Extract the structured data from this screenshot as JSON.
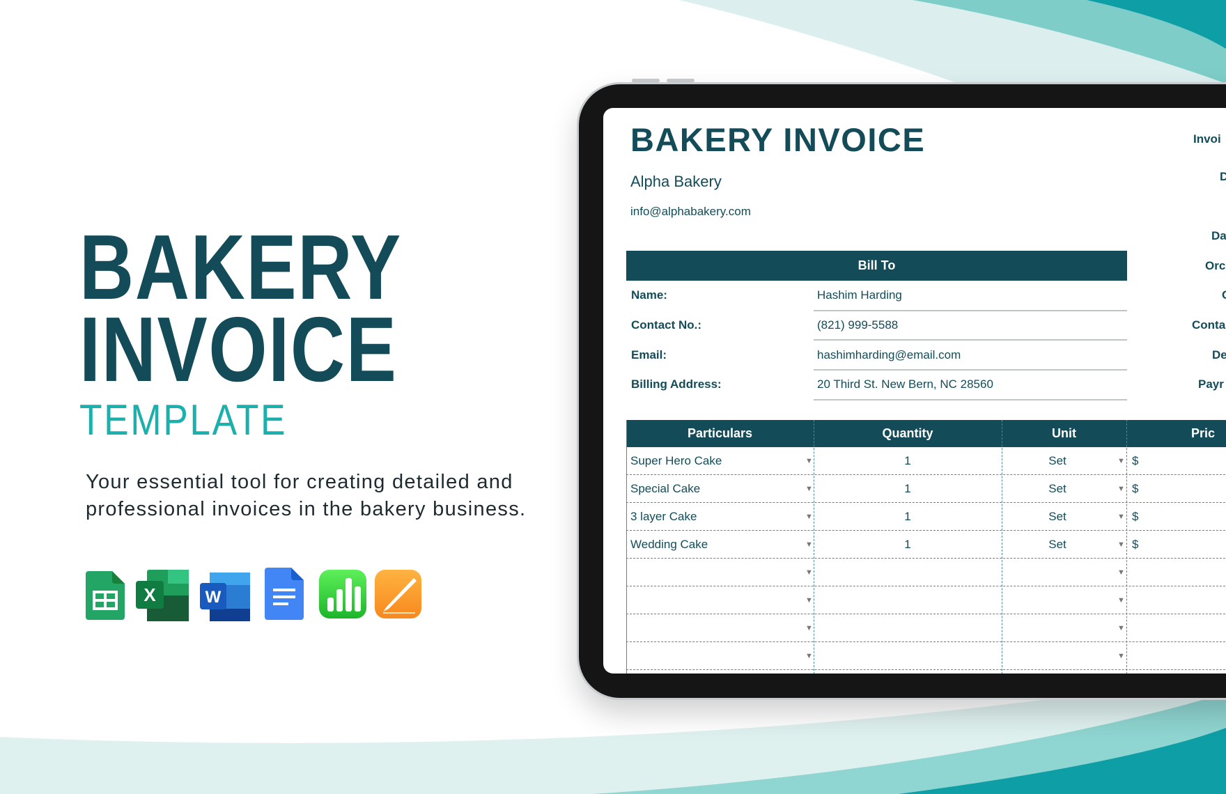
{
  "colors": {
    "brand_dark": "#134c58",
    "accent_teal": "#1bb0ac",
    "bg_teal": "#0e9ea6"
  },
  "promo": {
    "title_line1": "BAKERY",
    "title_line2": "INVOICE",
    "subtitle": "TEMPLATE",
    "description_line1": "Your essential tool for creating detailed and",
    "description_line2": "professional invoices in the bakery business."
  },
  "app_icons": [
    "google-sheets-icon",
    "excel-icon",
    "word-icon",
    "google-docs-icon",
    "numbers-icon",
    "pages-icon"
  ],
  "invoice": {
    "title": "BAKERY INVOICE",
    "company": "Alpha Bakery",
    "company_email": "info@alphabakery.com",
    "bill_to": {
      "header": "Bill To",
      "fields": [
        {
          "label": "Name:",
          "value": "Hashim Harding"
        },
        {
          "label": "Contact No.:",
          "value": "(821) 999-5588"
        },
        {
          "label": "Email:",
          "value": "hashimharding@email.com"
        },
        {
          "label": "Billing Address:",
          "value": "20 Third St. New Bern, NC 28560"
        }
      ]
    },
    "right_labels": [
      "Invoi",
      "D",
      "Da",
      "Orc",
      "C",
      "Conta",
      "De",
      "Payr"
    ],
    "table": {
      "headers": [
        "Particulars",
        "Quantity",
        "Unit",
        "Pric"
      ],
      "rows": [
        {
          "particular": "Super Hero Cake",
          "quantity": "1",
          "unit": "Set",
          "price": "$"
        },
        {
          "particular": "Special Cake",
          "quantity": "1",
          "unit": "Set",
          "price": "$"
        },
        {
          "particular": "3 layer Cake",
          "quantity": "1",
          "unit": "Set",
          "price": "$"
        },
        {
          "particular": "Wedding Cake",
          "quantity": "1",
          "unit": "Set",
          "price": "$"
        },
        {
          "particular": "",
          "quantity": "",
          "unit": "",
          "price": ""
        },
        {
          "particular": "",
          "quantity": "",
          "unit": "",
          "price": ""
        },
        {
          "particular": "",
          "quantity": "",
          "unit": "",
          "price": ""
        },
        {
          "particular": "",
          "quantity": "",
          "unit": "",
          "price": ""
        }
      ]
    }
  }
}
